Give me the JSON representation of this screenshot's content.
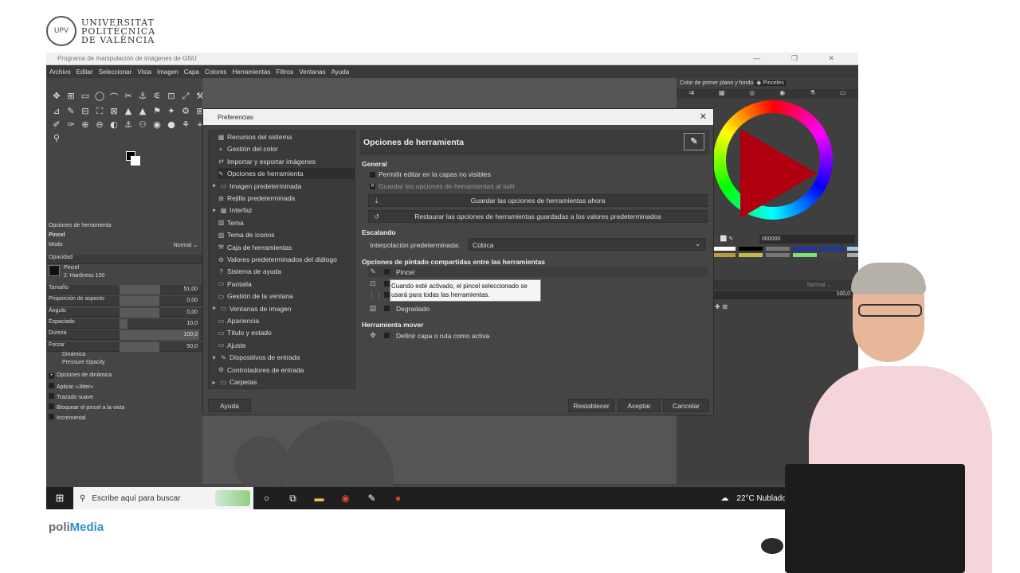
{
  "branding": {
    "university_line1": "UNIVERSITAT",
    "university_line2": "POLITÈCNICA",
    "university_line3": "DE VALÈNCIA",
    "polimedia_prefix": "poli",
    "polimedia_suffix": "Media"
  },
  "window": {
    "title": "Programa de manipulación de imágenes de GNU",
    "controls": [
      "—",
      "❐",
      "✕"
    ]
  },
  "menubar": [
    "Archivo",
    "Editar",
    "Seleccionar",
    "Vista",
    "Imagen",
    "Capa",
    "Colores",
    "Herramientas",
    "Filtros",
    "Ventanas",
    "Ayuda"
  ],
  "toolbox": {
    "icons": [
      "✥",
      "⊞",
      "▭",
      "◯",
      "⌒",
      "✂",
      "⚓",
      "⚟",
      "⊡",
      "⤢",
      "⚒",
      "⟆",
      "⊿",
      "✎",
      "⊟",
      "⛶",
      "⊠",
      "▲",
      "▲",
      "⚑",
      "✦",
      "⚙",
      "⊞",
      "◪",
      "✐",
      "✑",
      "⊕",
      "⊖",
      "◐",
      "⚓",
      "⚇",
      "◉",
      "●",
      "⚘",
      "⌖",
      "✚",
      "⚲"
    ],
    "active_options_tab": "Opciones de herramienta",
    "tool_name": "Pincel",
    "mode_label": "Modo",
    "mode_value": "Normal",
    "opacity_label": "Opacidad",
    "brush_label": "Pincel",
    "brush_value": "2. Hardness 100",
    "sliders": [
      {
        "label": "Tamaño",
        "value": "51,00",
        "fill": 0.51
      },
      {
        "label": "Proporción de aspecto",
        "value": "0,00",
        "fill": 0.5
      },
      {
        "label": "Ángulo",
        "value": "0,00",
        "fill": 0.5
      },
      {
        "label": "Espaciado",
        "value": "10,0",
        "fill": 0.1
      },
      {
        "label": "Dureza",
        "value": "100,0",
        "fill": 1.0
      },
      {
        "label": "Forzar",
        "value": "50,0",
        "fill": 0.5
      }
    ],
    "dynamics_label": "Dinámica",
    "dynamics_value": "Pressure Opacity",
    "options": [
      "Opciones de dinámica",
      "Aplicar «Jitter»",
      "Trazado suave",
      "Bloquear el pincel a la vista",
      "Incremental"
    ]
  },
  "right_dock": {
    "tab_fg_bg": "Color de primer plano y fondo",
    "tab_brushes": "Pinceles",
    "hex_value": "000000",
    "layer_mode": "Normal",
    "layer_opacity": "100,0",
    "swatches": [
      "#ffffff",
      "#000000",
      "#777777",
      "#2233aa",
      "#1a3a9a",
      "#9ec9e8",
      "#b89a40",
      "#c8b84a",
      "#777777",
      "#7be07b",
      "#444444",
      "#aaaaaa"
    ]
  },
  "dialog": {
    "title": "Preferencias",
    "tree": [
      {
        "label": "Recursos del sistema",
        "level": 1,
        "icon": "▦"
      },
      {
        "label": "Gestión del color",
        "level": 1,
        "icon": "◐"
      },
      {
        "label": "Importar y exportar imágenes",
        "level": 1,
        "icon": "⇄"
      },
      {
        "label": "Opciones de herramienta",
        "level": 1,
        "icon": "✎",
        "selected": true
      },
      {
        "label": "Imagen predeterminada",
        "level": 0,
        "icon": "▭",
        "expander": "▾"
      },
      {
        "label": "Rejilla predeterminada",
        "level": 1,
        "icon": "⊞"
      },
      {
        "label": "Interfaz",
        "level": 0,
        "icon": "▦",
        "expander": "▾"
      },
      {
        "label": "Tema",
        "level": 1,
        "icon": "▧"
      },
      {
        "label": "Tema de iconos",
        "level": 1,
        "icon": "▧"
      },
      {
        "label": "Caja de herramientas",
        "level": 1,
        "icon": "⚒"
      },
      {
        "label": "Valores predeterminados del diálogo",
        "level": 1,
        "icon": "⚙"
      },
      {
        "label": "Sistema de ayuda",
        "level": 1,
        "icon": "?"
      },
      {
        "label": "Pantalla",
        "level": 1,
        "icon": "▭"
      },
      {
        "label": "Gestión de la ventana",
        "level": 1,
        "icon": "▭"
      },
      {
        "label": "Ventanas de imagen",
        "level": 0,
        "icon": "▭",
        "expander": "▾"
      },
      {
        "label": "Apariencia",
        "level": 1,
        "icon": "▭"
      },
      {
        "label": "Título y estado",
        "level": 1,
        "icon": "▭"
      },
      {
        "label": "Ajuste",
        "level": 1,
        "icon": "▭"
      },
      {
        "label": "Dispositivos de entrada",
        "level": 0,
        "icon": "✎",
        "expander": "▾"
      },
      {
        "label": "Controladores de entrada",
        "level": 1,
        "icon": "⚙"
      },
      {
        "label": "Carpetas",
        "level": 0,
        "icon": "▭",
        "expander": "▸"
      }
    ],
    "panel_title": "Opciones de herramienta",
    "general_heading": "General",
    "chk_edit_invisible": "Permitir editar en la capas no visibles",
    "chk_save_on_exit": "Guardar las opciones de herramientas al salir",
    "btn_save_now": "Guardar las opciones de herramientas ahora",
    "btn_restore": "Restaurar las opciones de herramientas guardadas a los valores predeterminados",
    "scaling_heading": "Escalando",
    "interp_label": "Interpolación predeterminada:",
    "interp_value": "Cúbica",
    "paint_heading": "Opciones de pintado compartidas entre las herramientas",
    "paint_options": [
      "Pincel",
      "",
      "",
      "Degradado"
    ],
    "tooltip": "Cuando esté activado, el pincel seleccionado se usará para todas las herramientas.",
    "move_heading": "Herramienta mover",
    "move_option": "Definir capa o ruta como activa",
    "btn_help": "Ayuda",
    "btn_reset": "Restablecer",
    "btn_ok": "Aceptar",
    "btn_cancel": "Cancelar"
  },
  "taskbar": {
    "search_placeholder": "Escribe aquí para buscar",
    "weather": "22°C  Nublado"
  }
}
